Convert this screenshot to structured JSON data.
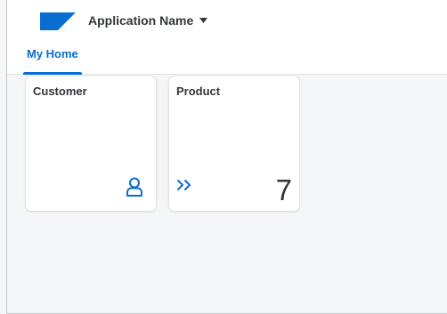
{
  "shell": {
    "app_name": "Application Name",
    "logo_icon": "company-logo",
    "menu_icon": "caret-down-icon",
    "accent_color": "#0a6ed1",
    "text_color": "#32363a"
  },
  "tabs": [
    {
      "label": "My Home",
      "selected": true
    }
  ],
  "tiles": [
    {
      "title": "Customer",
      "icon": "person-icon"
    },
    {
      "title": "Product",
      "icon": "double-chevron-right-icon",
      "value": "7"
    }
  ]
}
